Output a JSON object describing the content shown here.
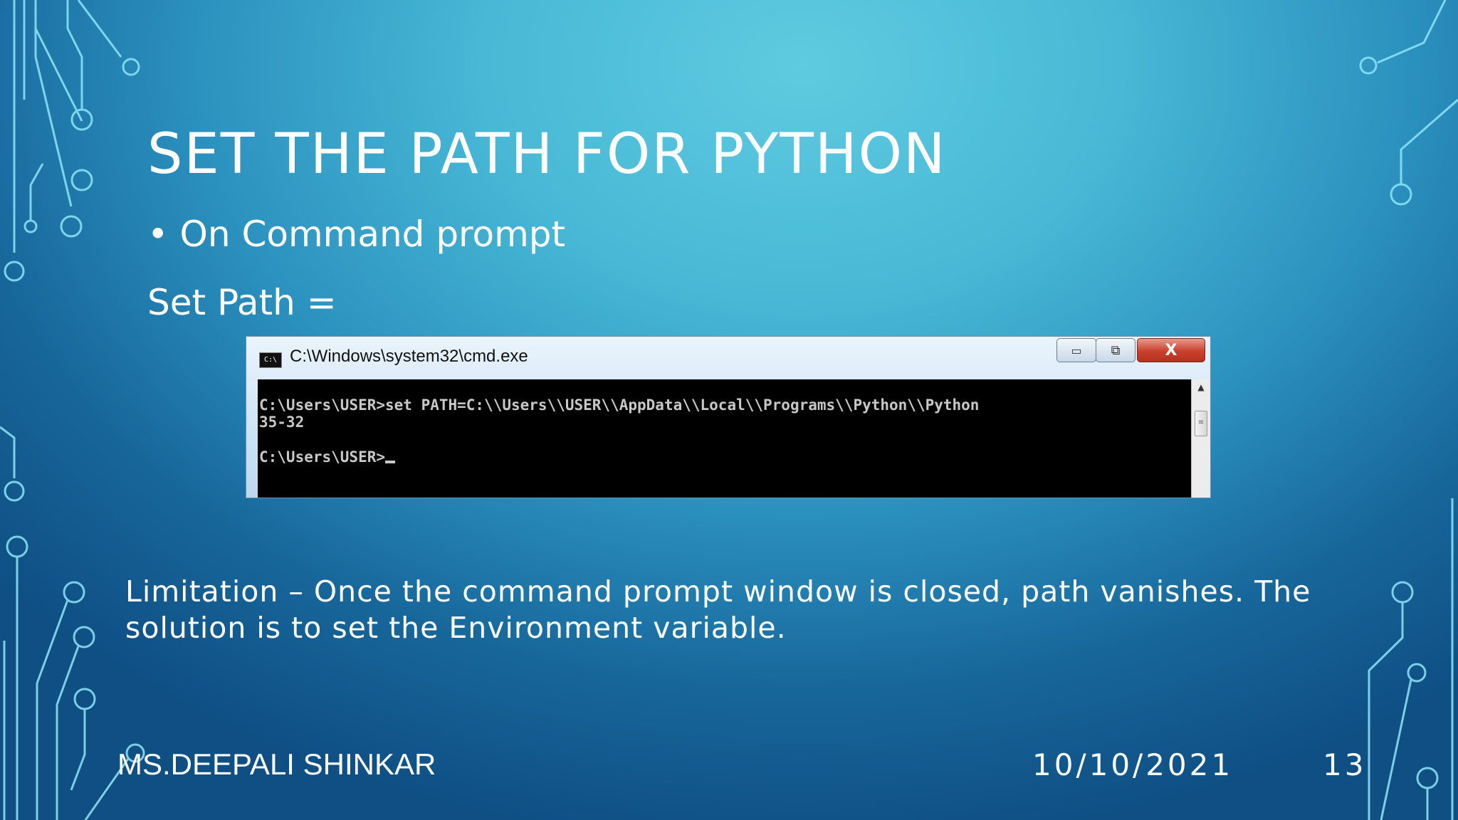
{
  "slide": {
    "title": "SET THE PATH FOR PYTHON",
    "bullet_symbol": "•",
    "bullet": "On Command prompt",
    "set_path": "Set Path =",
    "limitation": "Limitation – Once the command prompt window is closed, path vanishes. The solution is to set the Environment variable."
  },
  "cmd_window": {
    "icon_text": "C:\\",
    "title": "C:\\Windows\\system32\\cmd.exe",
    "minimize_symbol": "▭",
    "maximize_symbol": "⧉",
    "close_symbol": "X",
    "lines": [
      "C:\\Users\\USER>set PATH=C:\\\\Users\\\\USER\\\\AppData\\\\Local\\\\Programs\\\\Python\\\\Python",
      "35-32",
      "C:\\Users\\USER>"
    ],
    "scroll_up_symbol": "▲",
    "scroll_thumb_symbol": "≡"
  },
  "footer": {
    "author": "MS.DEEPALI SHINKAR",
    "date": "10/10/2021",
    "page": "13"
  },
  "colors": {
    "text": "#ffffff",
    "circuit": "#7fe0f5",
    "console_bg": "#000000",
    "close_button": "#c9402b"
  }
}
